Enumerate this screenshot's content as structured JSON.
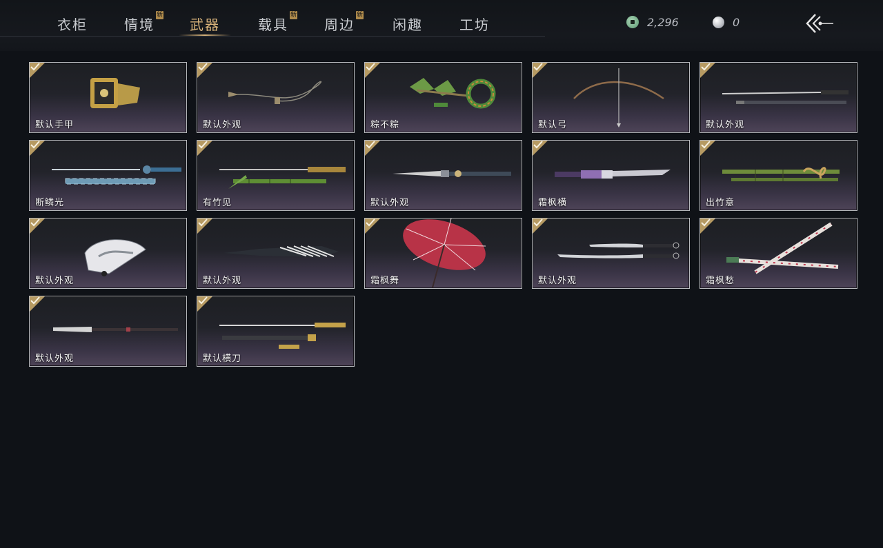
{
  "tabs": [
    {
      "label": "衣柜",
      "badge": ""
    },
    {
      "label": "情境",
      "badge": "新"
    },
    {
      "label": "武器",
      "badge": ""
    },
    {
      "label": "载具",
      "badge": "新"
    },
    {
      "label": "周边",
      "badge": "新"
    },
    {
      "label": "闲趣",
      "badge": ""
    },
    {
      "label": "工坊",
      "badge": ""
    }
  ],
  "active_tab": "武器",
  "currency": {
    "coin": {
      "icon": "jade-coin-icon",
      "value": "2,296"
    },
    "pearl": {
      "icon": "pearl-icon",
      "value": "0"
    }
  },
  "back_icon": "back-arrow-icon",
  "colors": {
    "accent": "#d7b27a",
    "check": "#b69a62",
    "background": "#0f1217"
  },
  "items": [
    {
      "name": "默认手甲",
      "icon": "gauntlet-icon",
      "owned": true
    },
    {
      "name": "默认外观",
      "icon": "rope-dart-icon",
      "owned": true
    },
    {
      "name": "粽不粽",
      "icon": "zongzi-weapon-icon",
      "owned": true
    },
    {
      "name": "默认弓",
      "icon": "bow-icon",
      "owned": true
    },
    {
      "name": "默认外观",
      "icon": "sword-pair-icon",
      "owned": true
    },
    {
      "name": "断鳞光",
      "icon": "blue-sword-icon",
      "owned": true
    },
    {
      "name": "有竹见",
      "icon": "bamboo-sword-icon",
      "owned": true
    },
    {
      "name": "默认外观",
      "icon": "dagger-icon",
      "owned": true
    },
    {
      "name": "霜枫横",
      "icon": "purple-blade-icon",
      "owned": true
    },
    {
      "name": "出竹意",
      "icon": "bamboo-staff-icon",
      "owned": true
    },
    {
      "name": "默认外观",
      "icon": "folding-fan-icon",
      "owned": true
    },
    {
      "name": "默认外观",
      "icon": "umbrella-closed-icon",
      "owned": true
    },
    {
      "name": "霜枫舞",
      "icon": "red-umbrella-icon",
      "owned": true
    },
    {
      "name": "默认外观",
      "icon": "twin-sabers-icon",
      "owned": true
    },
    {
      "name": "霜枫愁",
      "icon": "crossed-swords-icon",
      "owned": true
    },
    {
      "name": "默认外观",
      "icon": "glaive-icon",
      "owned": true
    },
    {
      "name": "默认横刀",
      "icon": "hengdao-icon",
      "owned": true
    }
  ]
}
